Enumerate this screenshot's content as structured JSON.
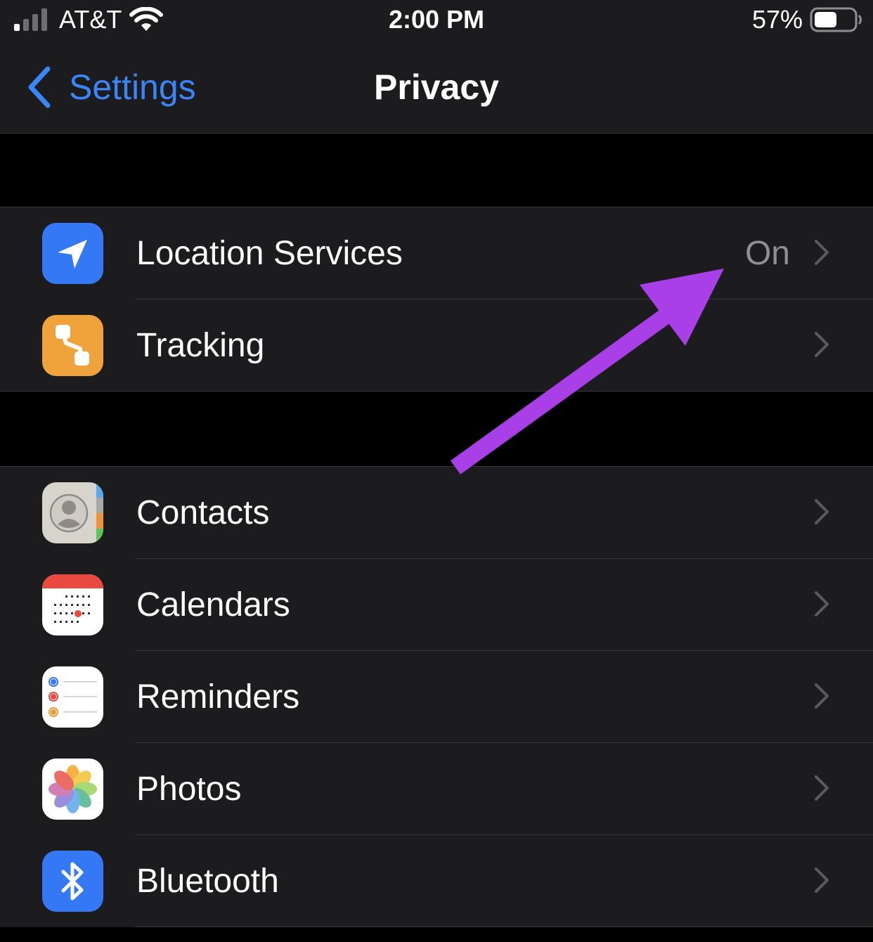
{
  "status_bar": {
    "carrier": "AT&T",
    "time": "2:00 PM",
    "battery_percent": "57%",
    "battery_level": 0.57,
    "icons": [
      "signal-bars-icon",
      "wifi-icon",
      "battery-icon"
    ]
  },
  "nav": {
    "back_label": "Settings",
    "title": "Privacy"
  },
  "groups": [
    {
      "items": [
        {
          "label": "Location Services",
          "value": "On",
          "icon": "location-arrow-icon",
          "icon_bg": "#3478f6"
        },
        {
          "label": "Tracking",
          "value": "",
          "icon": "tracking-icon",
          "icon_bg": "#f0a23b"
        }
      ]
    },
    {
      "items": [
        {
          "label": "Contacts",
          "icon": "contacts-icon"
        },
        {
          "label": "Calendars",
          "icon": "calendar-icon"
        },
        {
          "label": "Reminders",
          "icon": "reminders-icon"
        },
        {
          "label": "Photos",
          "icon": "photos-icon"
        },
        {
          "label": "Bluetooth",
          "icon": "bluetooth-icon",
          "icon_bg": "#3478f6"
        }
      ]
    }
  ],
  "colors": {
    "accent": "#3a86f7",
    "annotation_arrow": "#a93fe6",
    "cell_background": "#1c1c1e",
    "separator": "#38383a",
    "secondary_text": "#8e8e93"
  }
}
